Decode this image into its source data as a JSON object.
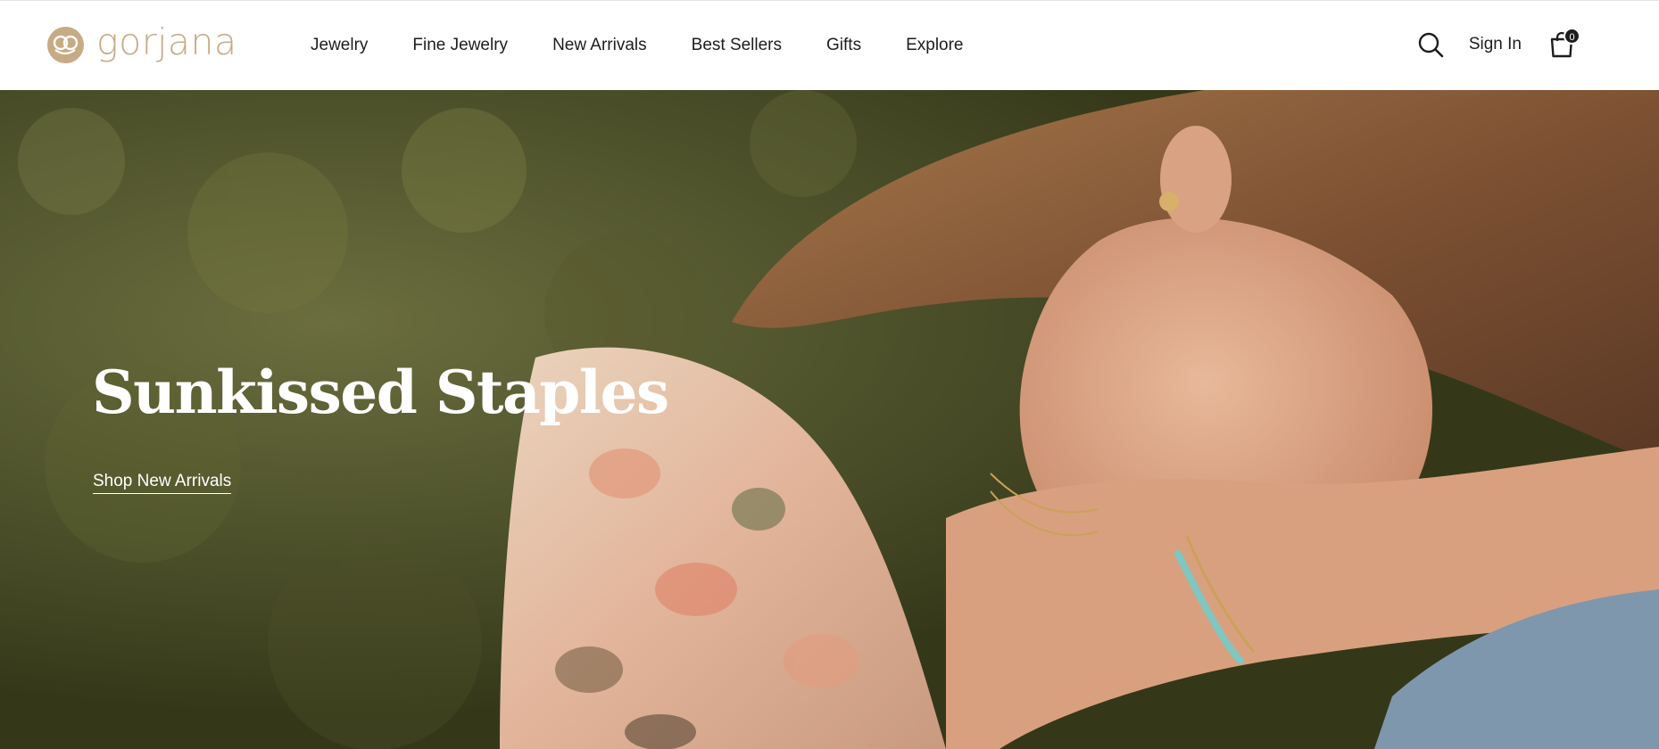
{
  "brand": {
    "name": "gorjana",
    "color": "#c7ab85"
  },
  "nav": {
    "items": [
      {
        "label": "Jewelry"
      },
      {
        "label": "Fine Jewelry"
      },
      {
        "label": "New Arrivals"
      },
      {
        "label": "Best Sellers"
      },
      {
        "label": "Gifts"
      },
      {
        "label": "Explore"
      }
    ]
  },
  "utils": {
    "search_icon": "search-icon",
    "signin_label": "Sign In",
    "bag_icon": "shopping-bag-icon",
    "bag_count": "0"
  },
  "hero": {
    "title": "Sunkissed Staples",
    "link_label": "Shop New Arrivals"
  }
}
